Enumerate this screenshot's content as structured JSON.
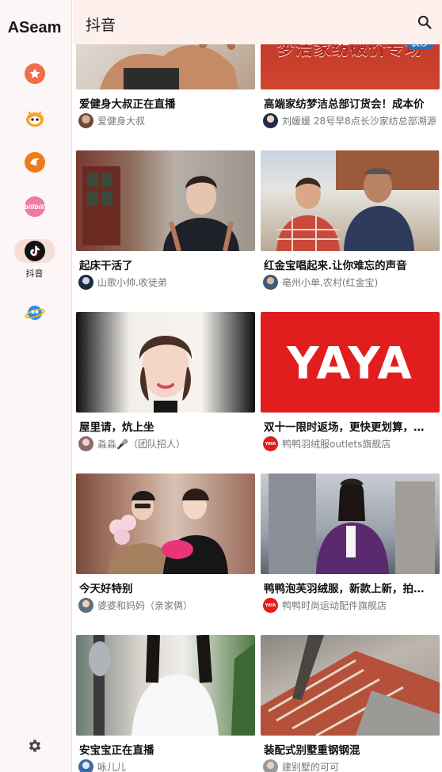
{
  "app": {
    "brand": "ASeam"
  },
  "sidebar": {
    "items": [
      {
        "name": "favorites",
        "icon": "star-icon",
        "color": "#f26b4a"
      },
      {
        "name": "kuaishou",
        "icon": "kuaishou-icon",
        "color": "#f5a623"
      },
      {
        "name": "pocket",
        "icon": "pocket-icon",
        "color": "#f07a1a"
      },
      {
        "name": "bilibili",
        "icon": "bilibili-icon",
        "color": "#f07aa1",
        "text": "bilibili"
      },
      {
        "name": "douyin",
        "icon": "douyin-icon",
        "color": "#111111",
        "label": "抖音",
        "active": true
      },
      {
        "name": "weibo",
        "icon": "globe-icon",
        "color": "#2a8ef0"
      }
    ]
  },
  "topbar": {
    "title": "抖音"
  },
  "feed": {
    "cards": [
      {
        "title": "爱健身大叔正在直播",
        "author": "爱健身大叔",
        "thumb": "fitness"
      },
      {
        "title": "高端家纺梦洁总部订货会！成本价",
        "author": "刘媛媛 28号早8点长沙家纺总部溯源",
        "thumb": "textile",
        "banner_text": "梦洁家纺破价专场",
        "banner_city": "长沙"
      },
      {
        "title": "起床干活了",
        "author": "山歌小帅.收徒弟",
        "thumb": "young-man"
      },
      {
        "title": "红金宝唱起来.让你难忘的声音",
        "author": "亳州小单.农村(红金宝)",
        "thumb": "village"
      },
      {
        "title": "屋里请，炕上坐",
        "author": "淼淼🎤（团队招人）",
        "thumb": "bride"
      },
      {
        "title": "双十一限时返场，更快更划算，…",
        "author": "鸭鸭羽绒服outlets旗舰店",
        "thumb": "yaya",
        "banner_text": "YAYA",
        "avatar_text": "YAYA"
      },
      {
        "title": "今天好特别",
        "author": "婆婆和妈妈（亲家俩）",
        "thumb": "ladies"
      },
      {
        "title": "鸭鸭泡芙羽绒服，新款上新，拍…",
        "author": "鸭鸭时尚运动配件旗舰店",
        "thumb": "street",
        "avatar_text": "YAYA"
      },
      {
        "title": "安宝宝正在直播",
        "author": "咏儿儿",
        "thumb": "singer"
      },
      {
        "title": "装配式别墅重钢钢混",
        "author": "建别墅的可可",
        "thumb": "bricks"
      }
    ]
  }
}
